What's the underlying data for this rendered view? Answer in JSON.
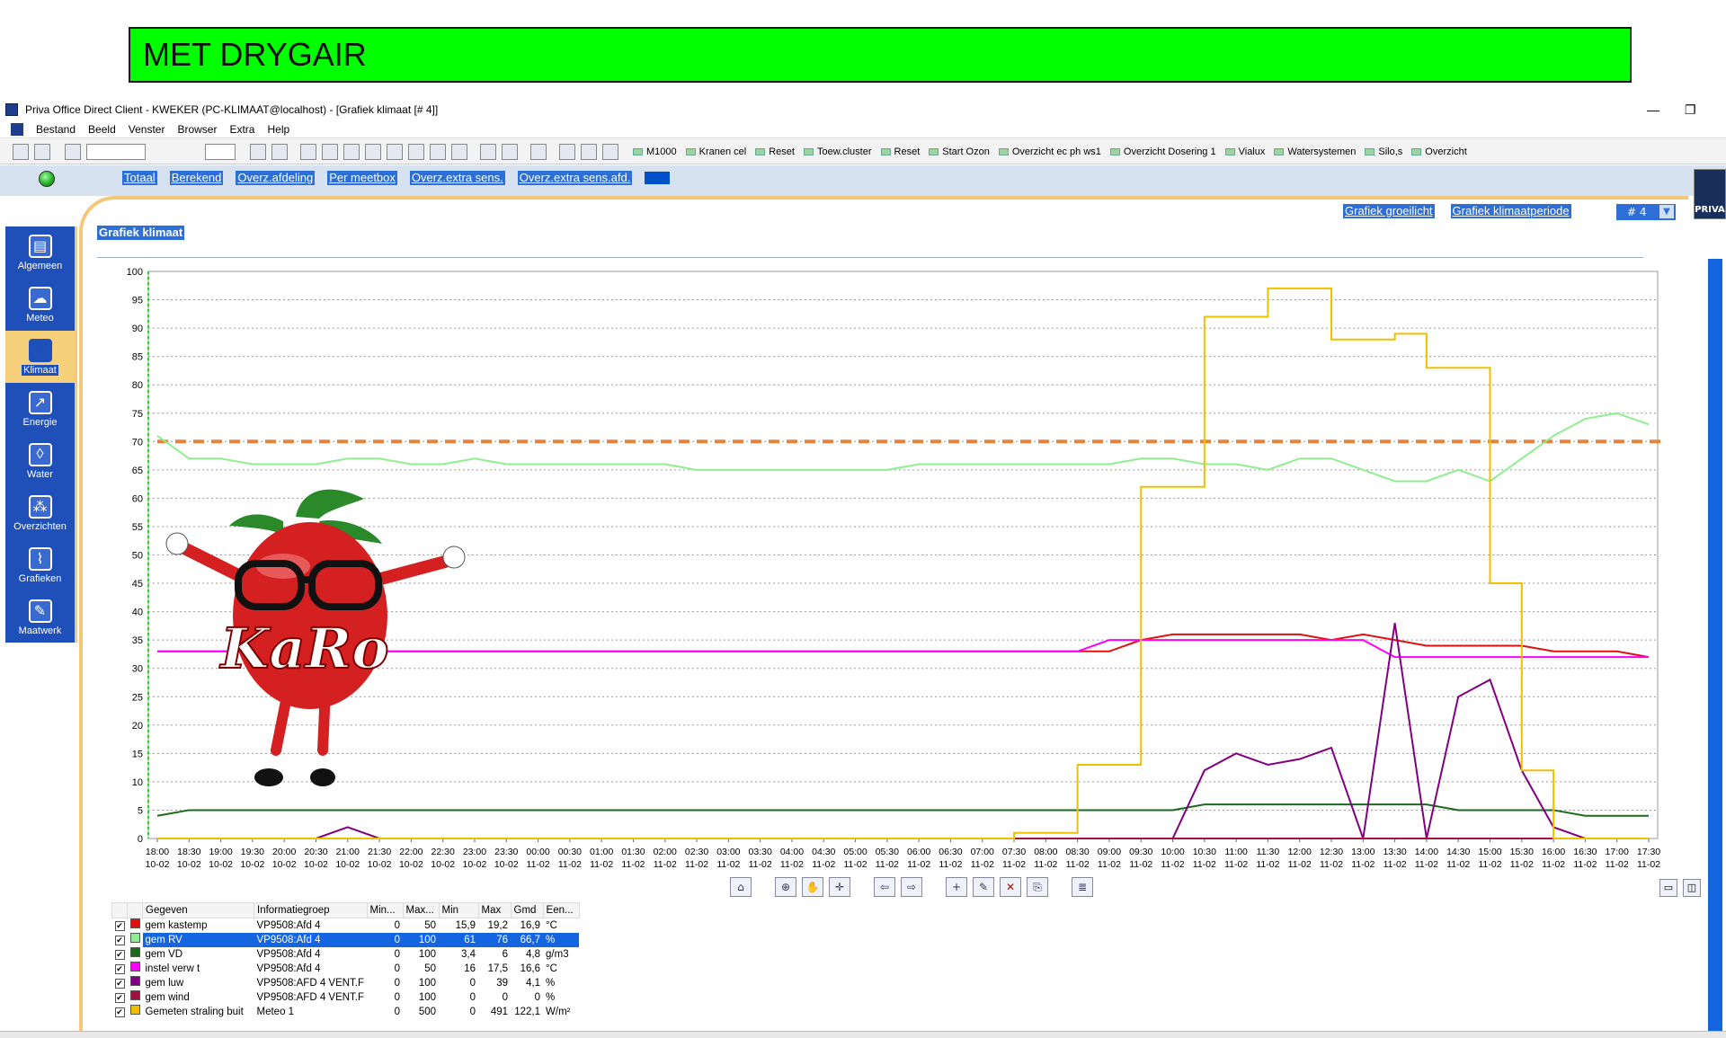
{
  "banner": {
    "text": "MET DRYGAIR"
  },
  "window": {
    "title": "Priva Office Direct Client - KWEKER (PC-KLIMAAT@localhost) - [Grafiek klimaat [# 4]]"
  },
  "menu": [
    "Bestand",
    "Beeld",
    "Venster",
    "Browser",
    "Extra",
    "Help"
  ],
  "quicklinks": [
    "M1000",
    "Kranen cel",
    "Reset",
    "Toew.cluster",
    "Reset",
    "Start Ozon",
    "Overzicht ec ph ws1",
    "Overzicht Dosering 1",
    "Vialux",
    "Watersystemen",
    "Silo,s",
    "Overzicht"
  ],
  "navtabs": [
    "Totaal",
    "Berekend",
    "Overz.afdeling",
    "Per meetbox",
    "Overz.extra sens.",
    "Overz.extra sens.afd."
  ],
  "sidebar": [
    {
      "label": "Algemeen",
      "icon": "clipboard-icon"
    },
    {
      "label": "Meteo",
      "icon": "cloud-icon"
    },
    {
      "label": "Klimaat",
      "icon": "sun-icon",
      "active": true
    },
    {
      "label": "Energie",
      "icon": "energy-chart-icon"
    },
    {
      "label": "Water",
      "icon": "water-drop-icon"
    },
    {
      "label": "Overzichten",
      "icon": "overview-icon"
    },
    {
      "label": "Grafieken",
      "icon": "graph-icon"
    },
    {
      "label": "Maatwerk",
      "icon": "pencil-icon"
    }
  ],
  "page": {
    "title": "Grafiek klimaat",
    "link_groeilicht": "Grafiek groeilicht",
    "link_klimaatperiode": "Grafiek klimaatperiode",
    "combo_value": "# 4",
    "logo_text": "PRIVA"
  },
  "mascot": {
    "text": "KaRo"
  },
  "legend": {
    "headers": [
      "Gegeven",
      "Informatiegroep",
      "Min...",
      "Max...",
      "Min",
      "Max",
      "Gmd",
      "Een..."
    ],
    "rows": [
      {
        "name": "gem kastemp",
        "group": "VP9508:Afd 4",
        "minr": "0",
        "maxr": "50",
        "min": "15,9",
        "max": "19,2",
        "avg": "16,9",
        "unit": "°C",
        "color": "#e01010",
        "selected": false
      },
      {
        "name": "gem RV",
        "group": "VP9508:Afd 4",
        "minr": "0",
        "maxr": "100",
        "min": "61",
        "max": "76",
        "avg": "66,7",
        "unit": "%",
        "color": "#90ee90",
        "selected": true
      },
      {
        "name": "gem VD",
        "group": "VP9508:Afd 4",
        "minr": "0",
        "maxr": "100",
        "min": "3,4",
        "max": "6",
        "avg": "4,8",
        "unit": "g/m3",
        "color": "#1a6a1a",
        "selected": false
      },
      {
        "name": "instel verw t",
        "group": "VP9508:Afd 4",
        "minr": "0",
        "maxr": "50",
        "min": "16",
        "max": "17,5",
        "avg": "16,6",
        "unit": "°C",
        "color": "#ff00ff",
        "selected": false
      },
      {
        "name": "gem luw",
        "group": "VP9508:AFD 4 VENT.F",
        "minr": "0",
        "maxr": "100",
        "min": "0",
        "max": "39",
        "avg": "4,1",
        "unit": "%",
        "color": "#800080",
        "selected": false
      },
      {
        "name": "gem wind",
        "group": "VP9508:AFD 4 VENT.F",
        "minr": "0",
        "maxr": "100",
        "min": "0",
        "max": "0",
        "avg": "0",
        "unit": "%",
        "color": "#a01040",
        "selected": false
      },
      {
        "name": "Gemeten straling buit",
        "group": "Meteo 1",
        "minr": "0",
        "maxr": "500",
        "min": "0",
        "max": "491",
        "avg": "122,1",
        "unit": "W/m²",
        "color": "#f0c000",
        "selected": false
      }
    ]
  },
  "chart_data": {
    "type": "line",
    "title": "",
    "xlabel": "",
    "ylabel": "",
    "ylim": [
      0,
      100
    ],
    "yticks": [
      0,
      5,
      10,
      15,
      20,
      25,
      30,
      35,
      40,
      45,
      50,
      55,
      60,
      65,
      70,
      75,
      80,
      85,
      90,
      95,
      100
    ],
    "x_time": [
      "18:00",
      "18:30",
      "19:00",
      "19:30",
      "20:00",
      "20:30",
      "21:00",
      "21:30",
      "22:00",
      "22:30",
      "23:00",
      "23:30",
      "00:00",
      "00:30",
      "01:00",
      "01:30",
      "02:00",
      "02:30",
      "03:00",
      "03:30",
      "04:00",
      "04:30",
      "05:00",
      "05:30",
      "06:00",
      "06:30",
      "07:00",
      "07:30",
      "08:00",
      "08:30",
      "09:00",
      "09:30",
      "10:00",
      "10:30",
      "11:00",
      "11:30",
      "12:00",
      "12:30",
      "13:00",
      "13:30",
      "14:00",
      "14:30",
      "15:00",
      "15:30",
      "16:00",
      "16:30",
      "17:00",
      "17:30"
    ],
    "x_date": [
      "10-02",
      "10-02",
      "10-02",
      "10-02",
      "10-02",
      "10-02",
      "10-02",
      "10-02",
      "10-02",
      "10-02",
      "10-02",
      "10-02",
      "11-02",
      "11-02",
      "11-02",
      "11-02",
      "11-02",
      "11-02",
      "11-02",
      "11-02",
      "11-02",
      "11-02",
      "11-02",
      "11-02",
      "11-02",
      "11-02",
      "11-02",
      "11-02",
      "11-02",
      "11-02",
      "11-02",
      "11-02",
      "11-02",
      "11-02",
      "11-02",
      "11-02",
      "11-02",
      "11-02",
      "11-02",
      "11-02",
      "11-02",
      "11-02",
      "11-02",
      "11-02",
      "11-02",
      "11-02",
      "11-02",
      "11-02"
    ],
    "grid": true,
    "reference_line": {
      "value": 70,
      "color": "#e8823a",
      "style": "dashed"
    },
    "series": [
      {
        "name": "gem RV",
        "color": "#90ee90",
        "values": [
          71,
          67,
          67,
          66,
          66,
          66,
          67,
          67,
          66,
          66,
          67,
          66,
          66,
          66,
          66,
          66,
          66,
          65,
          65,
          65,
          65,
          65,
          65,
          65,
          66,
          66,
          66,
          66,
          66,
          66,
          66,
          67,
          67,
          66,
          66,
          65,
          67,
          67,
          65,
          63,
          63,
          65,
          63,
          67,
          71,
          74,
          75,
          73
        ]
      },
      {
        "name": "gem kastemp",
        "color": "#e01010",
        "values": [
          33,
          33,
          33,
          33,
          33,
          33,
          33,
          33,
          33,
          33,
          33,
          33,
          33,
          33,
          33,
          33,
          33,
          33,
          33,
          33,
          33,
          33,
          33,
          33,
          33,
          33,
          33,
          33,
          33,
          33,
          33,
          35,
          36,
          36,
          36,
          36,
          36,
          35,
          36,
          35,
          34,
          34,
          34,
          34,
          33,
          33,
          33,
          32
        ]
      },
      {
        "name": "instel verw t",
        "color": "#ff00ff",
        "values": [
          33,
          33,
          33,
          33,
          33,
          33,
          33,
          33,
          33,
          33,
          33,
          33,
          33,
          33,
          33,
          33,
          33,
          33,
          33,
          33,
          33,
          33,
          33,
          33,
          33,
          33,
          33,
          33,
          33,
          33,
          35,
          35,
          35,
          35,
          35,
          35,
          35,
          35,
          35,
          32,
          32,
          32,
          32,
          32,
          32,
          32,
          32,
          32
        ]
      },
      {
        "name": "gem VD",
        "color": "#1a6a1a",
        "values": [
          4,
          5,
          5,
          5,
          5,
          5,
          5,
          5,
          5,
          5,
          5,
          5,
          5,
          5,
          5,
          5,
          5,
          5,
          5,
          5,
          5,
          5,
          5,
          5,
          5,
          5,
          5,
          5,
          5,
          5,
          5,
          5,
          5,
          6,
          6,
          6,
          6,
          6,
          6,
          6,
          6,
          5,
          5,
          5,
          5,
          4,
          4,
          4
        ]
      },
      {
        "name": "gem luw",
        "color": "#800080",
        "values": [
          0,
          0,
          0,
          0,
          0,
          0,
          2,
          0,
          0,
          0,
          0,
          0,
          0,
          0,
          0,
          0,
          0,
          0,
          0,
          0,
          0,
          0,
          0,
          0,
          0,
          0,
          0,
          0,
          0,
          0,
          0,
          0,
          0,
          12,
          15,
          13,
          14,
          16,
          0,
          38,
          0,
          25,
          28,
          12,
          2,
          0,
          0,
          0
        ]
      },
      {
        "name": "gem wind",
        "color": "#a01040",
        "values": [
          0,
          0,
          0,
          0,
          0,
          0,
          0,
          0,
          0,
          0,
          0,
          0,
          0,
          0,
          0,
          0,
          0,
          0,
          0,
          0,
          0,
          0,
          0,
          0,
          0,
          0,
          0,
          0,
          0,
          0,
          0,
          0,
          0,
          0,
          0,
          0,
          0,
          0,
          0,
          0,
          0,
          0,
          0,
          0,
          0,
          0,
          0,
          0
        ]
      },
      {
        "name": "Gemeten straling buit",
        "color": "#f0c000",
        "step": true,
        "values": [
          0,
          0,
          0,
          0,
          0,
          0,
          0,
          0,
          0,
          0,
          0,
          0,
          0,
          0,
          0,
          0,
          0,
          0,
          0,
          0,
          0,
          0,
          0,
          0,
          0,
          0,
          0,
          1,
          1,
          13,
          13,
          62,
          62,
          92,
          92,
          97,
          97,
          88,
          88,
          89,
          83,
          83,
          45,
          12,
          0,
          0,
          0,
          0
        ]
      }
    ]
  }
}
